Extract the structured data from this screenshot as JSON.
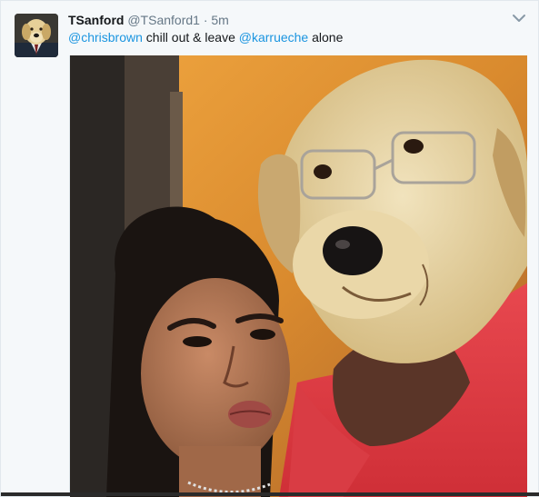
{
  "tweet": {
    "fullname": "TSanford",
    "screenname": "@TSanford1",
    "separator": "·",
    "timestamp": "5m",
    "text_parts": {
      "mention1": "@chrisbrown",
      "middle": " chill out & leave ",
      "mention2": "@karrueche",
      "end": " alone"
    }
  },
  "icons": {
    "avatar": "dog-avatar",
    "more": "chevron-down-icon"
  },
  "colors": {
    "link": "#1b95e0",
    "name": "#14171a",
    "meta": "#657786",
    "background": "#f5f8fa"
  }
}
